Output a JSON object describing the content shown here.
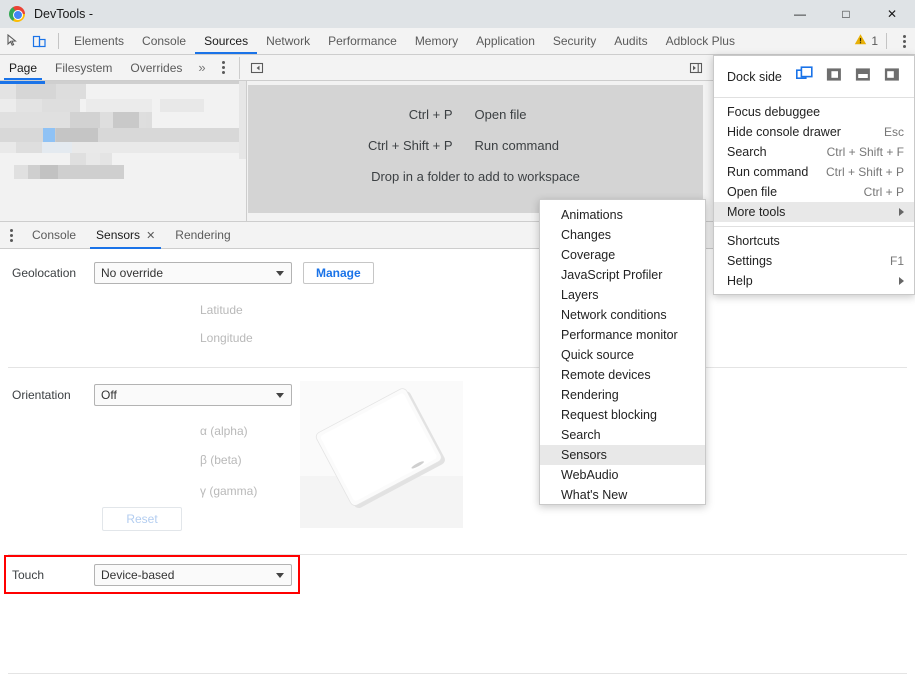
{
  "window": {
    "title": "DevTools -",
    "logo_icon": "chrome-logo",
    "minimize_label": "—",
    "maximize_label": "□",
    "close_label": "✕"
  },
  "toolbar": {
    "inspect_icon": "inspect-element-icon",
    "device_icon": "toggle-device-toolbar-icon",
    "tabs": [
      {
        "label": "Elements",
        "active": false
      },
      {
        "label": "Console",
        "active": false
      },
      {
        "label": "Sources",
        "active": true
      },
      {
        "label": "Network",
        "active": false
      },
      {
        "label": "Performance",
        "active": false
      },
      {
        "label": "Memory",
        "active": false
      },
      {
        "label": "Application",
        "active": false
      },
      {
        "label": "Security",
        "active": false
      },
      {
        "label": "Audits",
        "active": false
      },
      {
        "label": "Adblock Plus",
        "active": false
      }
    ],
    "warning_icon": "warning-triangle-icon",
    "warning_count": "1",
    "warning_color": "#e8b007",
    "menu_icon": "kebab-menu-icon"
  },
  "sources": {
    "subtabs": [
      {
        "label": "Page",
        "active": true
      },
      {
        "label": "Filesystem",
        "active": false
      },
      {
        "label": "Overrides",
        "active": false
      }
    ],
    "more_tabs_icon": "chevron-double-right-icon",
    "more_tabs_label": "»",
    "subtab_menu_icon": "kebab-menu-icon",
    "collapse_navigator_icon": "collapse-sidebar-icon",
    "show_debugger_icon": "show-debugger-sidebar-icon",
    "editor_hints": {
      "rows": [
        {
          "keys": "Ctrl + P",
          "action": "Open file"
        },
        {
          "keys": "Ctrl + Shift + P",
          "action": "Run command"
        }
      ],
      "drop_hint": "Drop in a folder to add to workspace"
    }
  },
  "drawer": {
    "menu_icon": "kebab-menu-icon",
    "tabs": [
      {
        "label": "Console",
        "active": false,
        "closable": false
      },
      {
        "label": "Sensors",
        "active": true,
        "closable": true
      },
      {
        "label": "Rendering",
        "active": false,
        "closable": false
      }
    ],
    "close_icon": "close-icon",
    "close_label": "✕"
  },
  "sensors": {
    "geolocation": {
      "label": "Geolocation",
      "value": "No override",
      "manage_label": "Manage",
      "latitude_label": "Latitude",
      "longitude_label": "Longitude"
    },
    "orientation": {
      "label": "Orientation",
      "value": "Off",
      "alpha_label": "α (alpha)",
      "beta_label": "β (beta)",
      "gamma_label": "γ (gamma)",
      "reset_label": "Reset",
      "device_preview_icon": "device-orientation-phone-preview"
    },
    "touch": {
      "label": "Touch",
      "value": "Device-based",
      "highlight_color": "#ff0000"
    }
  },
  "main_menu": {
    "dock_side": {
      "label": "Dock side",
      "options": [
        {
          "icon": "undock-into-separate-window-icon",
          "active": true
        },
        {
          "icon": "dock-to-left-icon",
          "active": false
        },
        {
          "icon": "dock-to-bottom-icon",
          "active": false
        },
        {
          "icon": "dock-to-right-icon",
          "active": false
        }
      ],
      "active_color": "#1a73e8"
    },
    "items": [
      {
        "label": "Focus debuggee",
        "shortcut": "",
        "submenu": false,
        "highlight": false
      },
      {
        "label": "Hide console drawer",
        "shortcut": "Esc",
        "submenu": false,
        "highlight": false
      },
      {
        "label": "Search",
        "shortcut": "Ctrl + Shift + F",
        "submenu": false,
        "highlight": false
      },
      {
        "label": "Run command",
        "shortcut": "Ctrl + Shift + P",
        "submenu": false,
        "highlight": false
      },
      {
        "label": "Open file",
        "shortcut": "Ctrl + P",
        "submenu": false,
        "highlight": false
      },
      {
        "label": "More tools",
        "shortcut": "",
        "submenu": true,
        "highlight": true
      }
    ],
    "items_after": [
      {
        "label": "Shortcuts",
        "shortcut": "",
        "submenu": false,
        "highlight": false
      },
      {
        "label": "Settings",
        "shortcut": "F1",
        "submenu": false,
        "highlight": false
      },
      {
        "label": "Help",
        "shortcut": "",
        "submenu": true,
        "highlight": false
      }
    ]
  },
  "more_tools_menu": {
    "items": [
      {
        "label": "Animations",
        "highlight": false
      },
      {
        "label": "Changes",
        "highlight": false
      },
      {
        "label": "Coverage",
        "highlight": false
      },
      {
        "label": "JavaScript Profiler",
        "highlight": false
      },
      {
        "label": "Layers",
        "highlight": false
      },
      {
        "label": "Network conditions",
        "highlight": false
      },
      {
        "label": "Performance monitor",
        "highlight": false
      },
      {
        "label": "Quick source",
        "highlight": false
      },
      {
        "label": "Remote devices",
        "highlight": false
      },
      {
        "label": "Rendering",
        "highlight": false
      },
      {
        "label": "Request blocking",
        "highlight": false
      },
      {
        "label": "Search",
        "highlight": false
      },
      {
        "label": "Sensors",
        "highlight": true
      },
      {
        "label": "WebAudio",
        "highlight": false
      },
      {
        "label": "What's New",
        "highlight": false
      }
    ]
  }
}
